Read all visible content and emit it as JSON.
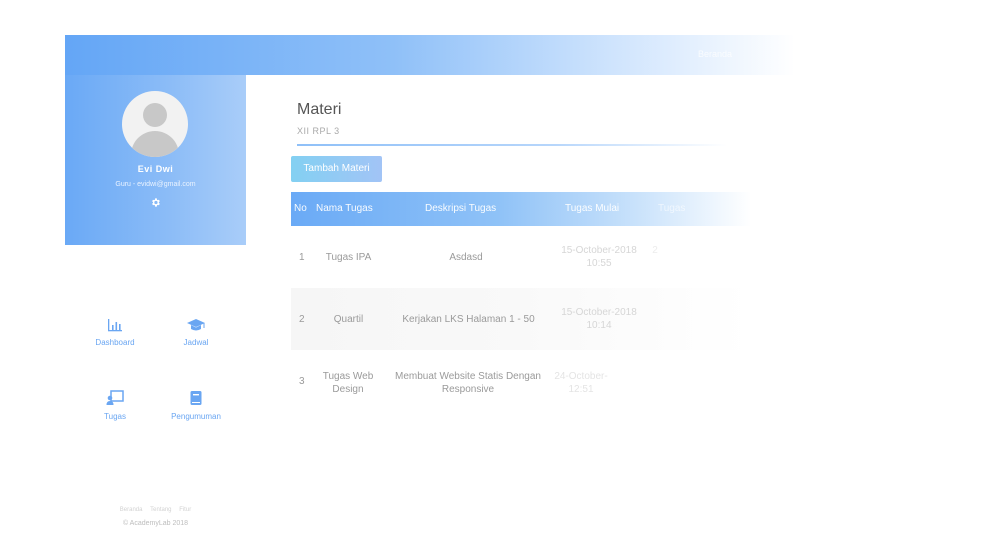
{
  "topbar": {
    "link_label": "Beranda"
  },
  "profile": {
    "name": "Evi Dwi",
    "subtitle": "Guru - evidwi@gmail.com"
  },
  "nav": {
    "items": [
      {
        "label": "Dashboard",
        "icon": "chart-icon"
      },
      {
        "label": "Jadwal",
        "icon": "graduation-cap-icon"
      },
      {
        "label": "Tugas",
        "icon": "presentation-icon"
      },
      {
        "label": "Pengumuman",
        "icon": "book-icon"
      }
    ]
  },
  "footer": {
    "links": [
      "Beranda",
      "Tentang",
      "Fitur"
    ],
    "copyright": "© AcademyLab 2018"
  },
  "main": {
    "title": "Materi",
    "subtitle": "XII RPL 3",
    "add_button": "Tambah Materi",
    "table": {
      "headers": [
        "No",
        "Nama Tugas",
        "Deskripsi Tugas",
        "Tugas Mulai",
        "Tugas"
      ],
      "rows": [
        {
          "no": "1",
          "name": "Tugas IPA",
          "desc": "Asdasd",
          "start": "15-October-2018 10:55",
          "extra": "2"
        },
        {
          "no": "2",
          "name": "Quartil",
          "desc": "Kerjakan LKS Halaman 1 - 50",
          "start": "15-October-2018 10:14",
          "extra": ""
        },
        {
          "no": "3",
          "name": "Tugas Web Design",
          "desc": "Membuat Website Statis Dengan Responsive",
          "start": "24-October- 12:51",
          "extra": ""
        }
      ]
    }
  },
  "colors": {
    "accent": "#6aa9f6",
    "button": "#83d0f2"
  }
}
